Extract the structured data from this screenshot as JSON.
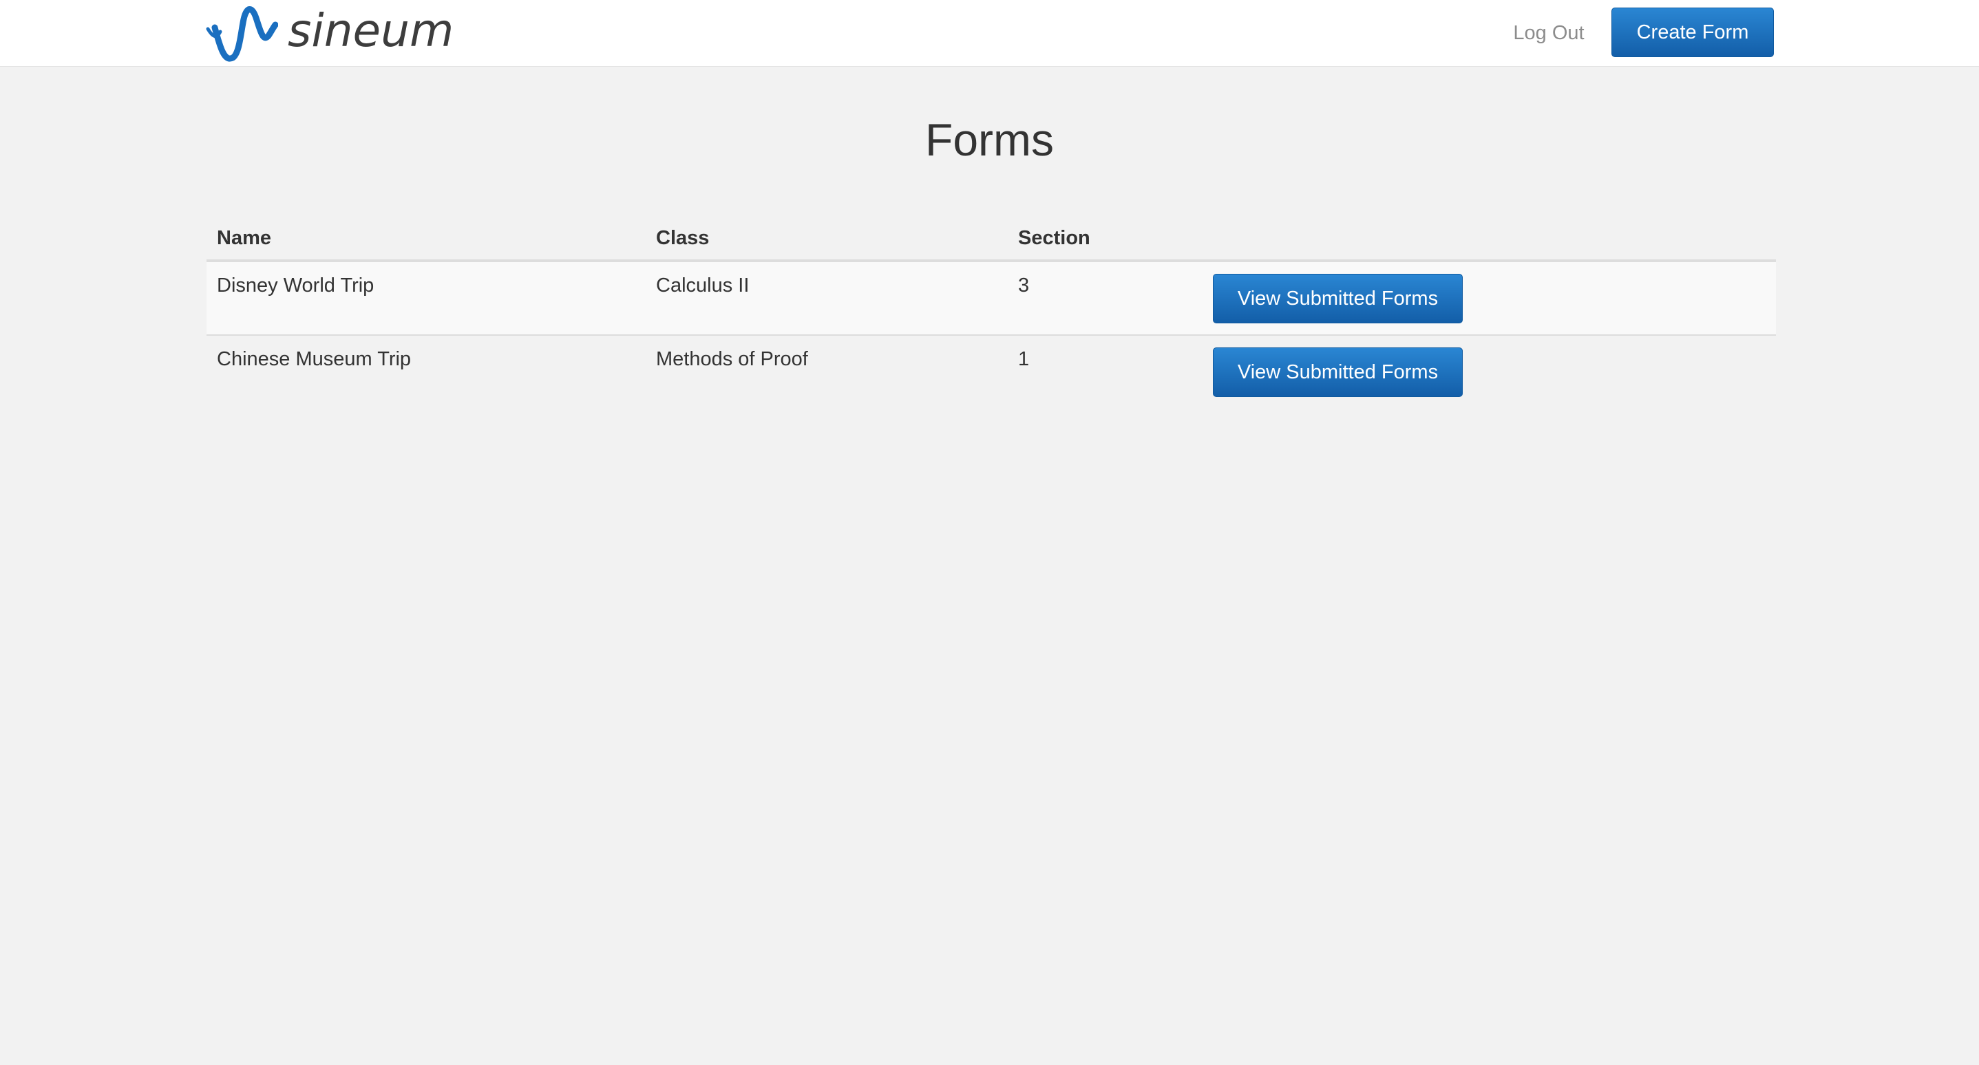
{
  "brand": {
    "name": "sineum",
    "logo_icon": "sine-wave-icon",
    "accent_color": "#1a6fc0"
  },
  "nav": {
    "logout_label": "Log Out",
    "create_form_label": "Create Form"
  },
  "page": {
    "title": "Forms"
  },
  "table": {
    "columns": [
      "Name",
      "Class",
      "Section",
      ""
    ],
    "rows": [
      {
        "name": "Disney World Trip",
        "class": "Calculus II",
        "section": "3",
        "action_label": "View Submitted Forms"
      },
      {
        "name": "Chinese Museum Trip",
        "class": "Methods of Proof",
        "section": "1",
        "action_label": "View Submitted Forms"
      }
    ]
  }
}
